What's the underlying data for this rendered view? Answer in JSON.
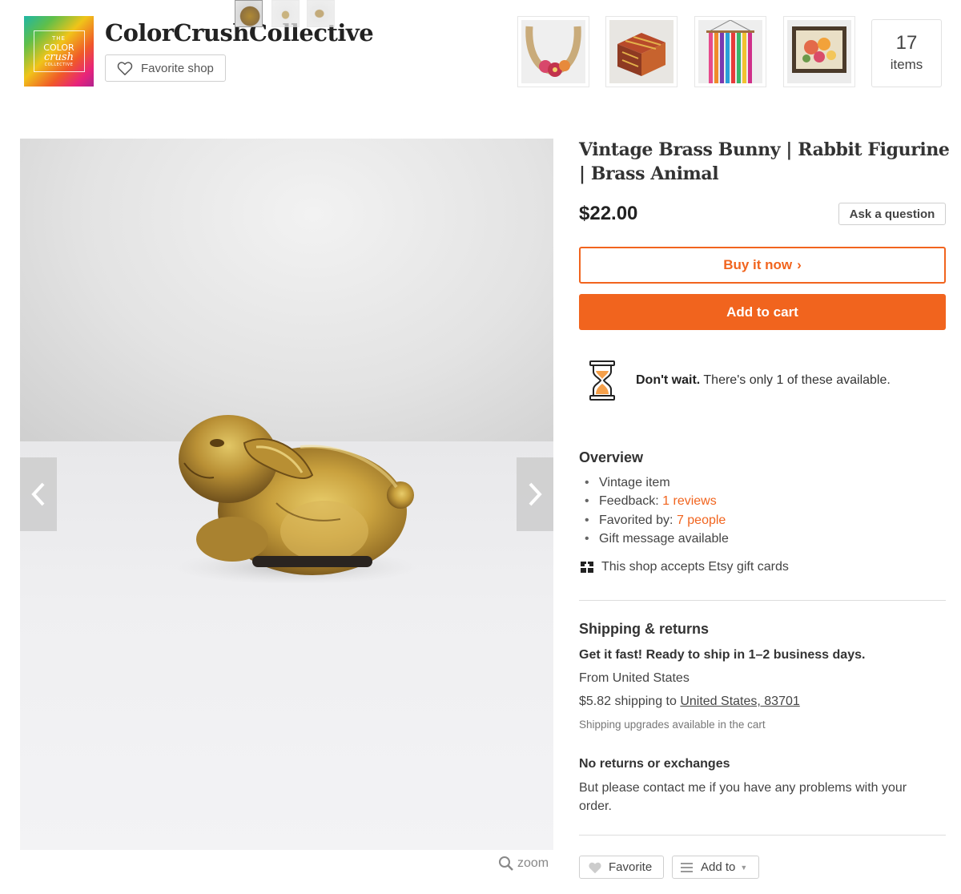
{
  "shop": {
    "logo_lines": [
      "THE",
      "COLOR",
      "crush",
      "COLLECTIVE"
    ],
    "name": "ColorCrushCollective",
    "favorite_label": "Favorite shop",
    "thumbnails": [
      "necklace",
      "box",
      "wall-hanging",
      "framed-floral"
    ],
    "items_count": "17",
    "items_label": "items"
  },
  "gallery": {
    "thumb_count": 3,
    "zoom_label": "zoom"
  },
  "listing": {
    "title": "Vintage Brass Bunny | Rabbit Figurine | Brass Animal",
    "price": "$22.00",
    "ask_label": "Ask a question",
    "buy_now_label": "Buy it now",
    "buy_now_chevron": "›",
    "add_to_cart_label": "Add to cart",
    "scarcity_bold": "Don't wait.",
    "scarcity_text": " There's only 1 of these available."
  },
  "overview": {
    "heading": "Overview",
    "vintage": "Vintage item",
    "feedback_label": "Feedback: ",
    "feedback_link": "1 reviews",
    "favorited_label": "Favorited by: ",
    "favorited_link": "7 people",
    "gift_message": "Gift message available",
    "gift_cards": "This shop accepts Etsy gift cards"
  },
  "shipping": {
    "heading": "Shipping & returns",
    "fast": "Get it fast! Ready to ship in 1–2 business days.",
    "from": "From United States",
    "cost_prefix": "$5.82 shipping to ",
    "destination": "United States, 83701",
    "upgrades": "Shipping upgrades available in the cart",
    "returns_heading": "No returns or exchanges",
    "returns_text": "But please contact me if you have any problems with your order."
  },
  "actions": {
    "favorite_label": "Favorite",
    "add_to_label": "Add to"
  },
  "colors": {
    "accent": "#f1641e",
    "text": "#222222",
    "muted": "#777777",
    "border": "#cfcfcf"
  }
}
